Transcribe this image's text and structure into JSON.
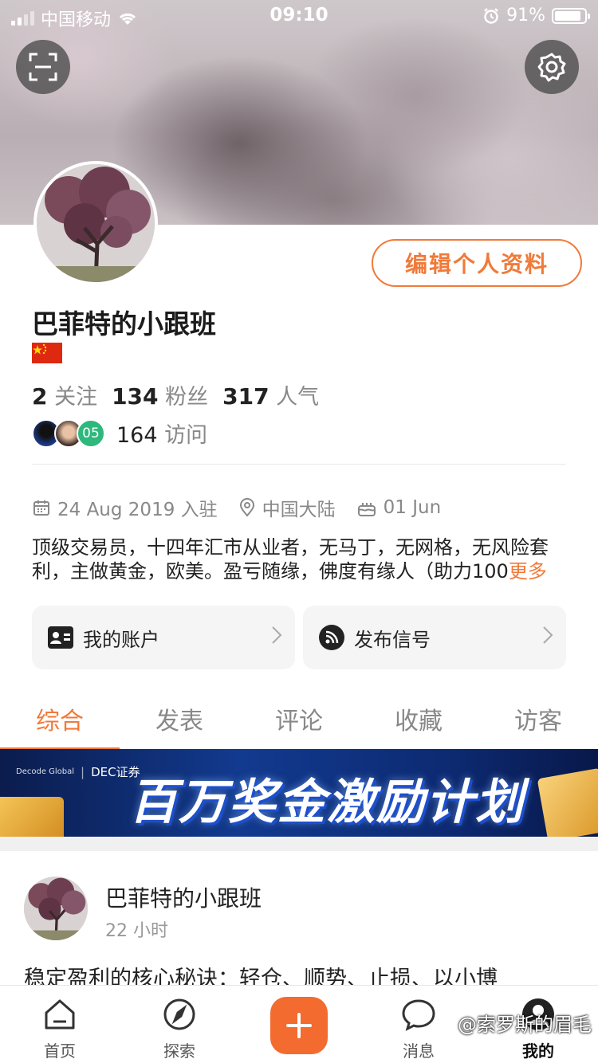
{
  "status_bar": {
    "carrier": "中国移动",
    "time": "09:10",
    "battery": "91%"
  },
  "profile": {
    "edit_label": "编辑个人资料",
    "username": "巴菲特的小跟班",
    "stats": [
      {
        "value": "2",
        "label": "关注"
      },
      {
        "value": "134",
        "label": "粉丝"
      },
      {
        "value": "317",
        "label": "人气"
      }
    ],
    "visitor_badge": "05",
    "visits_value": "164",
    "visits_label": "访问",
    "joined": "24 Aug 2019 入驻",
    "location": "中国大陆",
    "birthday": "01 Jun",
    "bio": "顶级交易员，十四年汇市从业者，无马丁，无网格，无风险套利，主做黄金，欧美。盈亏随缘，佛度有缘人（助力100",
    "bio_more": "更多"
  },
  "cards": {
    "account": "我的账户",
    "signal": "发布信号"
  },
  "tabs": [
    "综合",
    "发表",
    "评论",
    "收藏",
    "访客"
  ],
  "banner": {
    "brand_small": "Decode Global",
    "brand": "DEC证券",
    "title": "百万奖金激励计划"
  },
  "post": {
    "author": "巴菲特的小跟班",
    "time": "22 小时",
    "text": "稳定盈利的核心秘诀：轻仓、顺势、止损、以小博"
  },
  "bottom_nav": {
    "home": "首页",
    "explore": "探索",
    "messages": "消息",
    "mine": "我的"
  },
  "watermark": "@索罗斯的眉毛",
  "colors": {
    "accent": "#f07a3a",
    "plus_button": "#f36b2f",
    "visitor_badge": "#2fb87c"
  }
}
